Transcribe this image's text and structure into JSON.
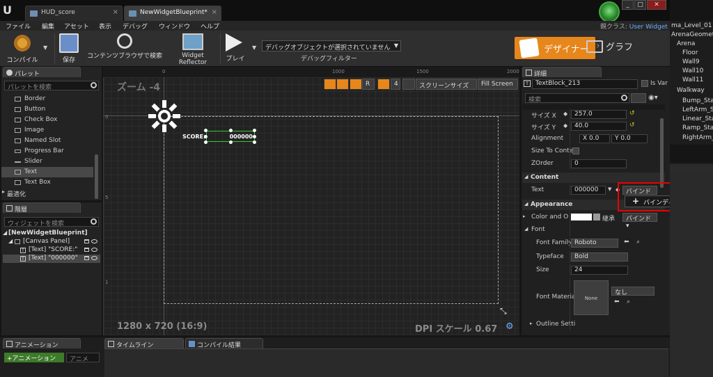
{
  "tabs": [
    {
      "label": "HUD_score"
    },
    {
      "label": "NewWidgetBlueprint*"
    }
  ],
  "menu": [
    "ファイル",
    "編集",
    "アセット",
    "表示",
    "デバッグ",
    "ウィンドウ",
    "ヘルプ"
  ],
  "parent_class": {
    "prefix": "親クラス:",
    "value": "User Widget"
  },
  "toolbar": {
    "compile": "コンパイル",
    "save": "保存",
    "content_browser": "コンテンツブラウザで検索",
    "widget_reflector": "Widget Reflector",
    "play": "プレイ",
    "debug_select": "デバッグオブジェクトが選択されていません",
    "debug_filter": "デバッグフィルター"
  },
  "mode": {
    "designer": "デザイナー",
    "graph": "グラフ"
  },
  "palette": {
    "title": "パレット",
    "search_placeholder": "パレットを検索",
    "items": [
      "Border",
      "Button",
      "Check Box",
      "Image",
      "Named Slot",
      "Progress Bar",
      "Slider",
      "Text",
      "Text Box"
    ],
    "selected_index": 7,
    "section": "最適化"
  },
  "hierarchy": {
    "title": "階層",
    "search_placeholder": "ウィジェットを検索",
    "root": "[NewWidgetBlueprint]",
    "items": [
      "[Canvas Panel]",
      "[Text] \"SCORE:\"",
      "[Text] \"000000\""
    ]
  },
  "viewport": {
    "zoom": "ズーム -4",
    "resolution": "1280 x 720 (16:9)",
    "dpi": "DPI スケール 0.67",
    "r_label": "R",
    "grid": "4",
    "screen_size": "スクリーンサイズ",
    "fill_screen": "Fill Screen",
    "ruler_top": [
      "0",
      "1000",
      "1500",
      "2000"
    ],
    "ruler_left": [
      "0",
      "5",
      "1"
    ],
    "score_label": "SCORE:",
    "score_value": "000000"
  },
  "details": {
    "title": "詳細",
    "name": "TextBlock_213",
    "is_variable": "Is Var",
    "search_placeholder": "検索",
    "size_x_label": "サイズ X",
    "size_x": "257.0",
    "size_y_label": "サイズ Y",
    "size_y": "40.0",
    "alignment_label": "Alignment",
    "align_x_lbl": "X",
    "align_x": "0.0",
    "align_y_lbl": "Y",
    "align_y": "0.0",
    "size_to_content": "Size To Conten",
    "zorder_label": "ZOrder",
    "zorder": "0",
    "content_cat": "Content",
    "text_label": "Text",
    "text_value": "000000",
    "bind": "バインド",
    "appearance_cat": "Appearance",
    "color_label": "Color and O",
    "inherit": "継承",
    "font_label": "Font",
    "font_family_label": "Font Family",
    "font_family": "Roboto",
    "typeface_label": "Typeface",
    "typeface": "Bold",
    "size_label": "Size",
    "size": "24",
    "font_material_label": "Font Materia",
    "none_thumb": "None",
    "none_select": "なし",
    "outline_label": "Outline Setti",
    "create_binding": "バインディングを作成"
  },
  "outliner": [
    "ma_Level_01 (1",
    "ArenaGeometry",
    "Arena",
    "Floor",
    "Wall9",
    "Wall10",
    "Wall11",
    "Walkway",
    "Bump_Stat",
    "LeftArm_St",
    "Linear_Sta",
    "Ramp_Stat",
    "RightArm_"
  ],
  "bottom": {
    "animation": "アニメーション",
    "add_animation": "+アニメーション",
    "anim_search": "アニメ",
    "timeline": "タイムライン",
    "compile_results": "コンパイル結果"
  },
  "colors": {
    "accent": "#e7861b",
    "selection": "#33cc33",
    "highlight": "#e00000"
  }
}
